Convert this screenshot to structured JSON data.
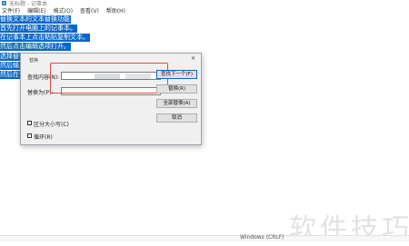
{
  "window": {
    "title": "无标题 - 记事本"
  },
  "menu": [
    "文件(F)",
    "编辑(E)",
    "格式(O)",
    "查看(V)",
    "帮助(H)"
  ],
  "editor": {
    "lines": [
      "替换文本的文本替换功能",
      "首先打开电脑上的记事本。",
      "在记事本上点击粘贴复制文本。",
      "然后点击编辑选项打开。",
      "选择替换选项",
      "然后输入",
      "然后在替"
    ]
  },
  "dialog": {
    "title": "替换",
    "close_icon": "close-icon",
    "find_label": "查找内容(N):",
    "replace_label": "替换为(P):",
    "buttons": {
      "find_next": "查找下一个(F)",
      "replace": "替换(R)",
      "replace_all": "全部替换(A)",
      "cancel": "取消"
    },
    "match_case": "区分大小写(C)",
    "wrap_around": "循环(R)",
    "find_value": "",
    "replace_value": ""
  },
  "watermark": "软件技巧",
  "status": {
    "encoding": "Windows (CRLF)"
  },
  "colors": {
    "selection": "#0a67c9",
    "highlight_box": "#e04848"
  }
}
